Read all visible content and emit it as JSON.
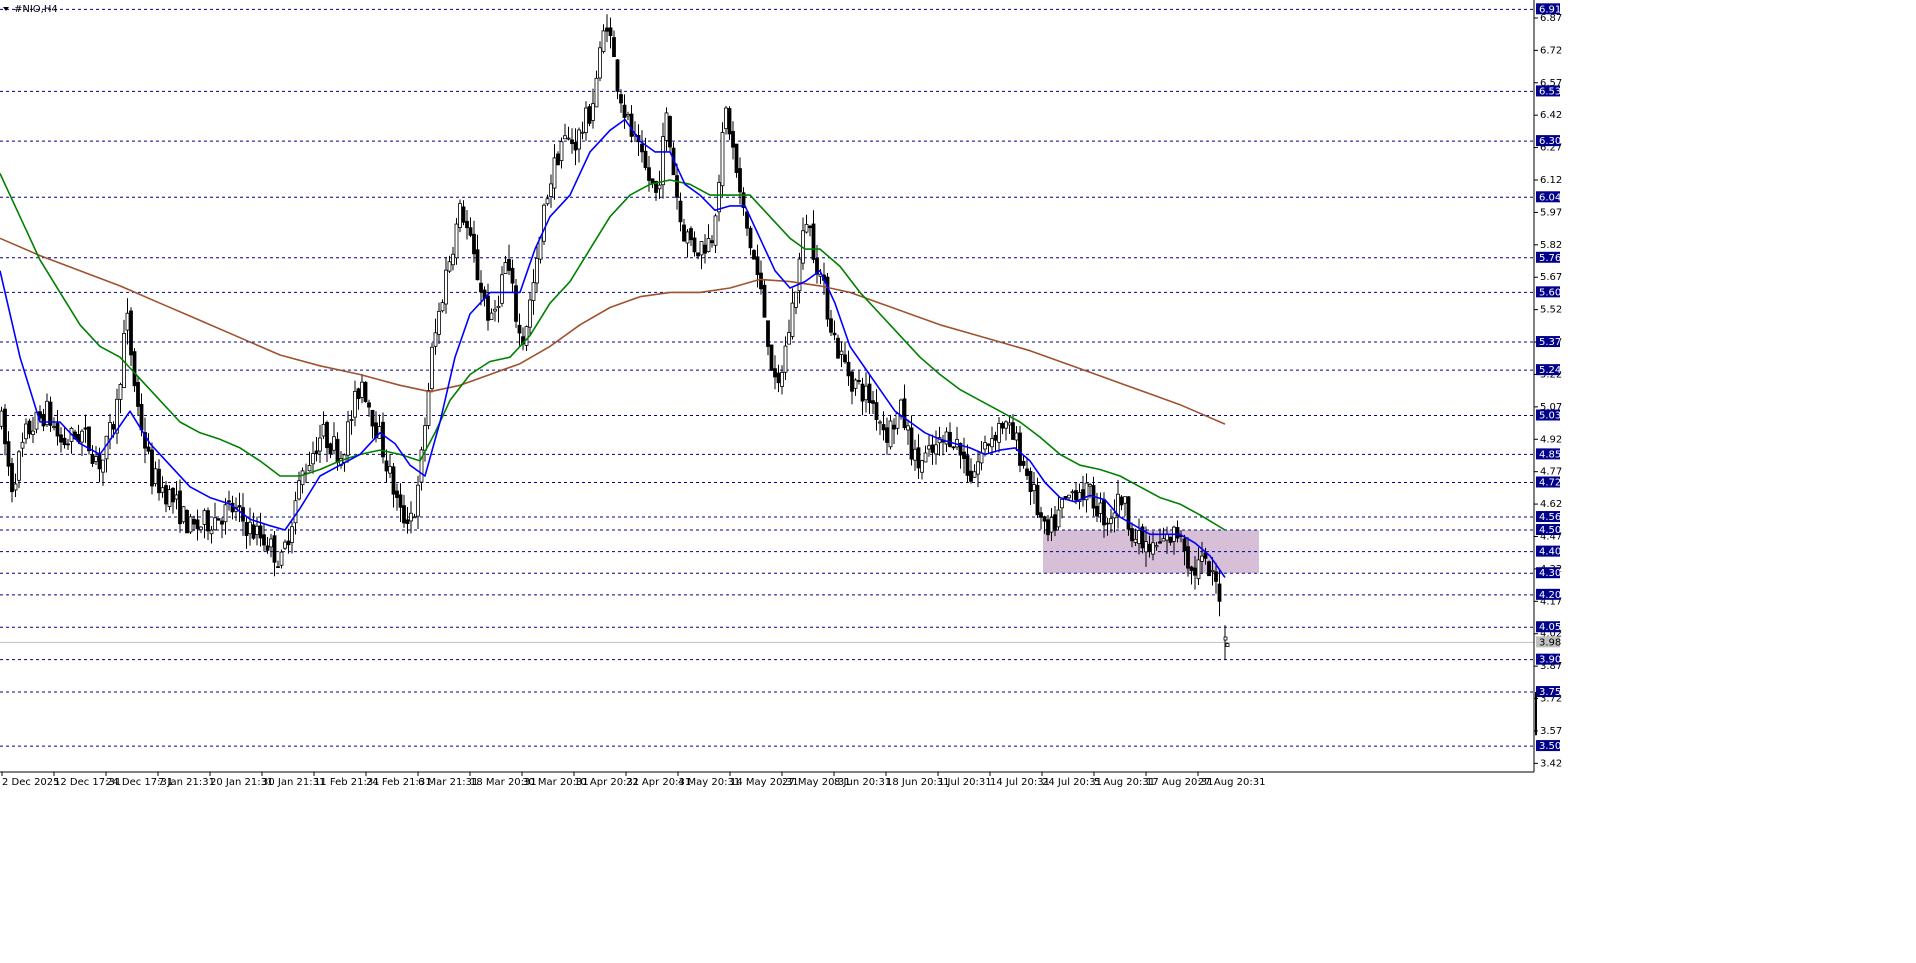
{
  "window": {
    "title": "#NIO,H4"
  },
  "chart_data": {
    "type": "candlestick",
    "symbol": "#NIO",
    "timeframe": "H4",
    "ylim": [
      3.38,
      6.93
    ],
    "colors": {
      "background": "#ffffff",
      "candle": "#000000",
      "grid_level": "#00008b",
      "ma_fast": "#0000ff",
      "ma_mid": "#008000",
      "ma_slow": "#a0522d",
      "zone": "#d8bfd8",
      "current_price_line": "#c0c0c0"
    },
    "y_tick_labels": [
      "6.87",
      "6.72",
      "6.57",
      "6.42",
      "6.27",
      "6.12",
      "5.97",
      "5.82",
      "5.67",
      "5.52",
      "5.37",
      "5.22",
      "5.07",
      "4.92",
      "4.77",
      "4.62",
      "4.47",
      "4.32",
      "4.17",
      "4.02",
      "3.87",
      "3.72",
      "3.57",
      "3.42"
    ],
    "y_ticks": [
      6.87,
      6.72,
      6.57,
      6.42,
      6.27,
      6.12,
      5.97,
      5.82,
      5.67,
      5.52,
      5.37,
      5.22,
      5.07,
      4.92,
      4.77,
      4.62,
      4.47,
      4.32,
      4.17,
      4.02,
      3.87,
      3.72,
      3.57,
      3.42
    ],
    "level_labels": [
      "6.91",
      "6.53",
      "6.30",
      "6.04",
      "5.76",
      "5.60",
      "5.37",
      "5.24",
      "5.03",
      "4.85",
      "4.72",
      "4.56",
      "4.50",
      "4.40",
      "4.30",
      "4.20",
      "4.05",
      "3.90",
      "3.75",
      "3.50"
    ],
    "levels": [
      6.91,
      6.53,
      6.3,
      6.04,
      5.76,
      5.6,
      5.37,
      5.24,
      5.03,
      4.85,
      4.72,
      4.56,
      4.5,
      4.4,
      4.3,
      4.2,
      4.05,
      3.9,
      3.75,
      3.5
    ],
    "current_price": 3.98,
    "current_price_label": "3.98",
    "x_tick_labels": [
      "2 Dec 2025",
      "12 Dec 17:31",
      "24 Dec 17:31",
      "7 Jan 21:31",
      "20 Jan 21:31",
      "30 Jan 21:31",
      "11 Feb 21:31",
      "24 Feb 21:31",
      "6 Mar 21:31",
      "18 Mar 20:31",
      "30 Mar 20:31",
      "10 Apr 20:31",
      "22 Apr 20:31",
      "4 May 20:31",
      "14 May 20:31",
      "27 May 20:31",
      "8 Jun 20:31",
      "18 Jun 20:31",
      "1 Jul 20:31",
      "14 Jul 20:31",
      "24 Jul 20:31",
      "5 Aug 20:31",
      "17 Aug 20:31",
      "27 Aug 20:31"
    ],
    "zone": {
      "top": 4.5,
      "bottom": 4.3
    },
    "price_path": [
      [
        0,
        5.0
      ],
      [
        10,
        4.7
      ],
      [
        25,
        4.95
      ],
      [
        45,
        5.05
      ],
      [
        60,
        4.9
      ],
      [
        80,
        4.95
      ],
      [
        100,
        4.8
      ],
      [
        115,
        5.05
      ],
      [
        125,
        5.5
      ],
      [
        135,
        5.1
      ],
      [
        150,
        4.75
      ],
      [
        170,
        4.65
      ],
      [
        190,
        4.5
      ],
      [
        210,
        4.55
      ],
      [
        230,
        4.6
      ],
      [
        250,
        4.5
      ],
      [
        265,
        4.45
      ],
      [
        280,
        4.35
      ],
      [
        300,
        4.75
      ],
      [
        320,
        4.95
      ],
      [
        340,
        4.85
      ],
      [
        360,
        5.2
      ],
      [
        380,
        4.9
      ],
      [
        400,
        4.55
      ],
      [
        415,
        4.6
      ],
      [
        430,
        5.3
      ],
      [
        445,
        5.7
      ],
      [
        460,
        6.0
      ],
      [
        475,
        5.7
      ],
      [
        490,
        5.45
      ],
      [
        505,
        5.75
      ],
      [
        520,
        5.35
      ],
      [
        535,
        5.7
      ],
      [
        545,
        6.05
      ],
      [
        560,
        6.3
      ],
      [
        575,
        6.3
      ],
      [
        590,
        6.45
      ],
      [
        605,
        6.88
      ],
      [
        615,
        6.6
      ],
      [
        625,
        6.4
      ],
      [
        640,
        6.2
      ],
      [
        655,
        6.05
      ],
      [
        665,
        6.4
      ],
      [
        680,
        5.9
      ],
      [
        695,
        5.8
      ],
      [
        710,
        5.85
      ],
      [
        725,
        6.45
      ],
      [
        740,
        6.0
      ],
      [
        755,
        5.7
      ],
      [
        765,
        5.45
      ],
      [
        775,
        5.1
      ],
      [
        790,
        5.5
      ],
      [
        805,
        5.95
      ],
      [
        820,
        5.65
      ],
      [
        835,
        5.35
      ],
      [
        850,
        5.2
      ],
      [
        870,
        5.1
      ],
      [
        885,
        4.95
      ],
      [
        900,
        5.05
      ],
      [
        915,
        4.8
      ],
      [
        930,
        4.85
      ],
      [
        950,
        4.95
      ],
      [
        970,
        4.75
      ],
      [
        985,
        4.9
      ],
      [
        1000,
        5.0
      ],
      [
        1015,
        4.9
      ],
      [
        1030,
        4.7
      ],
      [
        1045,
        4.45
      ],
      [
        1060,
        4.6
      ],
      [
        1075,
        4.7
      ],
      [
        1090,
        4.65
      ],
      [
        1105,
        4.55
      ],
      [
        1120,
        4.65
      ],
      [
        1135,
        4.45
      ],
      [
        1150,
        4.4
      ],
      [
        1165,
        4.45
      ],
      [
        1180,
        4.5
      ],
      [
        1190,
        4.3
      ],
      [
        1200,
        4.35
      ],
      [
        1210,
        4.28
      ],
      [
        1220,
        4.2
      ]
    ],
    "last_candles": [
      [
        1224,
        4.06,
        4.0,
        3.9
      ],
      [
        1226,
        3.98,
        3.97,
        3.96
      ]
    ],
    "ma_fast": [
      [
        0,
        5.7
      ],
      [
        20,
        5.3
      ],
      [
        40,
        5.0
      ],
      [
        60,
        5.0
      ],
      [
        80,
        4.9
      ],
      [
        100,
        4.85
      ],
      [
        115,
        4.95
      ],
      [
        130,
        5.05
      ],
      [
        150,
        4.9
      ],
      [
        170,
        4.8
      ],
      [
        190,
        4.7
      ],
      [
        210,
        4.65
      ],
      [
        230,
        4.62
      ],
      [
        250,
        4.55
      ],
      [
        270,
        4.52
      ],
      [
        285,
        4.5
      ],
      [
        300,
        4.6
      ],
      [
        320,
        4.75
      ],
      [
        340,
        4.8
      ],
      [
        360,
        4.85
      ],
      [
        380,
        4.95
      ],
      [
        395,
        4.9
      ],
      [
        410,
        4.8
      ],
      [
        425,
        4.75
      ],
      [
        440,
        5.0
      ],
      [
        455,
        5.3
      ],
      [
        470,
        5.5
      ],
      [
        490,
        5.6
      ],
      [
        505,
        5.6
      ],
      [
        520,
        5.6
      ],
      [
        535,
        5.8
      ],
      [
        550,
        5.95
      ],
      [
        570,
        6.05
      ],
      [
        590,
        6.25
      ],
      [
        610,
        6.35
      ],
      [
        625,
        6.4
      ],
      [
        640,
        6.3
      ],
      [
        655,
        6.25
      ],
      [
        670,
        6.25
      ],
      [
        685,
        6.1
      ],
      [
        700,
        6.05
      ],
      [
        715,
        5.98
      ],
      [
        730,
        6.0
      ],
      [
        745,
        6.0
      ],
      [
        760,
        5.85
      ],
      [
        775,
        5.7
      ],
      [
        790,
        5.62
      ],
      [
        805,
        5.65
      ],
      [
        820,
        5.7
      ],
      [
        835,
        5.55
      ],
      [
        850,
        5.35
      ],
      [
        865,
        5.25
      ],
      [
        880,
        5.15
      ],
      [
        895,
        5.05
      ],
      [
        910,
        5.0
      ],
      [
        925,
        4.95
      ],
      [
        940,
        4.92
      ],
      [
        955,
        4.9
      ],
      [
        970,
        4.88
      ],
      [
        985,
        4.85
      ],
      [
        1000,
        4.87
      ],
      [
        1015,
        4.88
      ],
      [
        1030,
        4.82
      ],
      [
        1045,
        4.72
      ],
      [
        1060,
        4.65
      ],
      [
        1075,
        4.63
      ],
      [
        1090,
        4.66
      ],
      [
        1105,
        4.64
      ],
      [
        1120,
        4.56
      ],
      [
        1135,
        4.52
      ],
      [
        1150,
        4.48
      ],
      [
        1165,
        4.48
      ],
      [
        1180,
        4.48
      ],
      [
        1195,
        4.44
      ],
      [
        1210,
        4.38
      ],
      [
        1225,
        4.28
      ]
    ],
    "ma_mid": [
      [
        0,
        6.15
      ],
      [
        20,
        5.95
      ],
      [
        40,
        5.75
      ],
      [
        60,
        5.6
      ],
      [
        80,
        5.45
      ],
      [
        100,
        5.35
      ],
      [
        120,
        5.3
      ],
      [
        140,
        5.2
      ],
      [
        160,
        5.1
      ],
      [
        180,
        5.0
      ],
      [
        200,
        4.95
      ],
      [
        220,
        4.92
      ],
      [
        240,
        4.88
      ],
      [
        260,
        4.82
      ],
      [
        280,
        4.75
      ],
      [
        300,
        4.75
      ],
      [
        320,
        4.78
      ],
      [
        340,
        4.82
      ],
      [
        360,
        4.85
      ],
      [
        380,
        4.87
      ],
      [
        400,
        4.85
      ],
      [
        420,
        4.82
      ],
      [
        435,
        4.95
      ],
      [
        450,
        5.1
      ],
      [
        470,
        5.22
      ],
      [
        490,
        5.28
      ],
      [
        510,
        5.3
      ],
      [
        530,
        5.4
      ],
      [
        550,
        5.55
      ],
      [
        570,
        5.65
      ],
      [
        590,
        5.8
      ],
      [
        610,
        5.95
      ],
      [
        630,
        6.05
      ],
      [
        650,
        6.1
      ],
      [
        670,
        6.12
      ],
      [
        690,
        6.1
      ],
      [
        710,
        6.05
      ],
      [
        730,
        6.05
      ],
      [
        750,
        6.05
      ],
      [
        770,
        5.95
      ],
      [
        790,
        5.85
      ],
      [
        805,
        5.8
      ],
      [
        820,
        5.8
      ],
      [
        840,
        5.72
      ],
      [
        860,
        5.6
      ],
      [
        880,
        5.5
      ],
      [
        900,
        5.4
      ],
      [
        920,
        5.3
      ],
      [
        940,
        5.22
      ],
      [
        960,
        5.15
      ],
      [
        980,
        5.1
      ],
      [
        1000,
        5.05
      ],
      [
        1020,
        5.0
      ],
      [
        1040,
        4.93
      ],
      [
        1060,
        4.85
      ],
      [
        1080,
        4.8
      ],
      [
        1100,
        4.78
      ],
      [
        1120,
        4.75
      ],
      [
        1140,
        4.7
      ],
      [
        1160,
        4.65
      ],
      [
        1180,
        4.62
      ],
      [
        1200,
        4.57
      ],
      [
        1225,
        4.5
      ]
    ],
    "ma_slow": [
      [
        0,
        5.85
      ],
      [
        40,
        5.77
      ],
      [
        80,
        5.7
      ],
      [
        120,
        5.63
      ],
      [
        160,
        5.55
      ],
      [
        200,
        5.47
      ],
      [
        240,
        5.39
      ],
      [
        280,
        5.31
      ],
      [
        320,
        5.26
      ],
      [
        360,
        5.22
      ],
      [
        400,
        5.17
      ],
      [
        430,
        5.14
      ],
      [
        460,
        5.17
      ],
      [
        490,
        5.22
      ],
      [
        520,
        5.27
      ],
      [
        550,
        5.35
      ],
      [
        580,
        5.45
      ],
      [
        610,
        5.53
      ],
      [
        640,
        5.58
      ],
      [
        670,
        5.6
      ],
      [
        700,
        5.6
      ],
      [
        730,
        5.62
      ],
      [
        760,
        5.66
      ],
      [
        790,
        5.65
      ],
      [
        820,
        5.63
      ],
      [
        850,
        5.6
      ],
      [
        880,
        5.55
      ],
      [
        910,
        5.5
      ],
      [
        940,
        5.45
      ],
      [
        970,
        5.41
      ],
      [
        1000,
        5.37
      ],
      [
        1030,
        5.33
      ],
      [
        1060,
        5.28
      ],
      [
        1090,
        5.23
      ],
      [
        1120,
        5.18
      ],
      [
        1150,
        5.13
      ],
      [
        1180,
        5.08
      ],
      [
        1200,
        5.04
      ],
      [
        1225,
        4.99
      ]
    ]
  }
}
